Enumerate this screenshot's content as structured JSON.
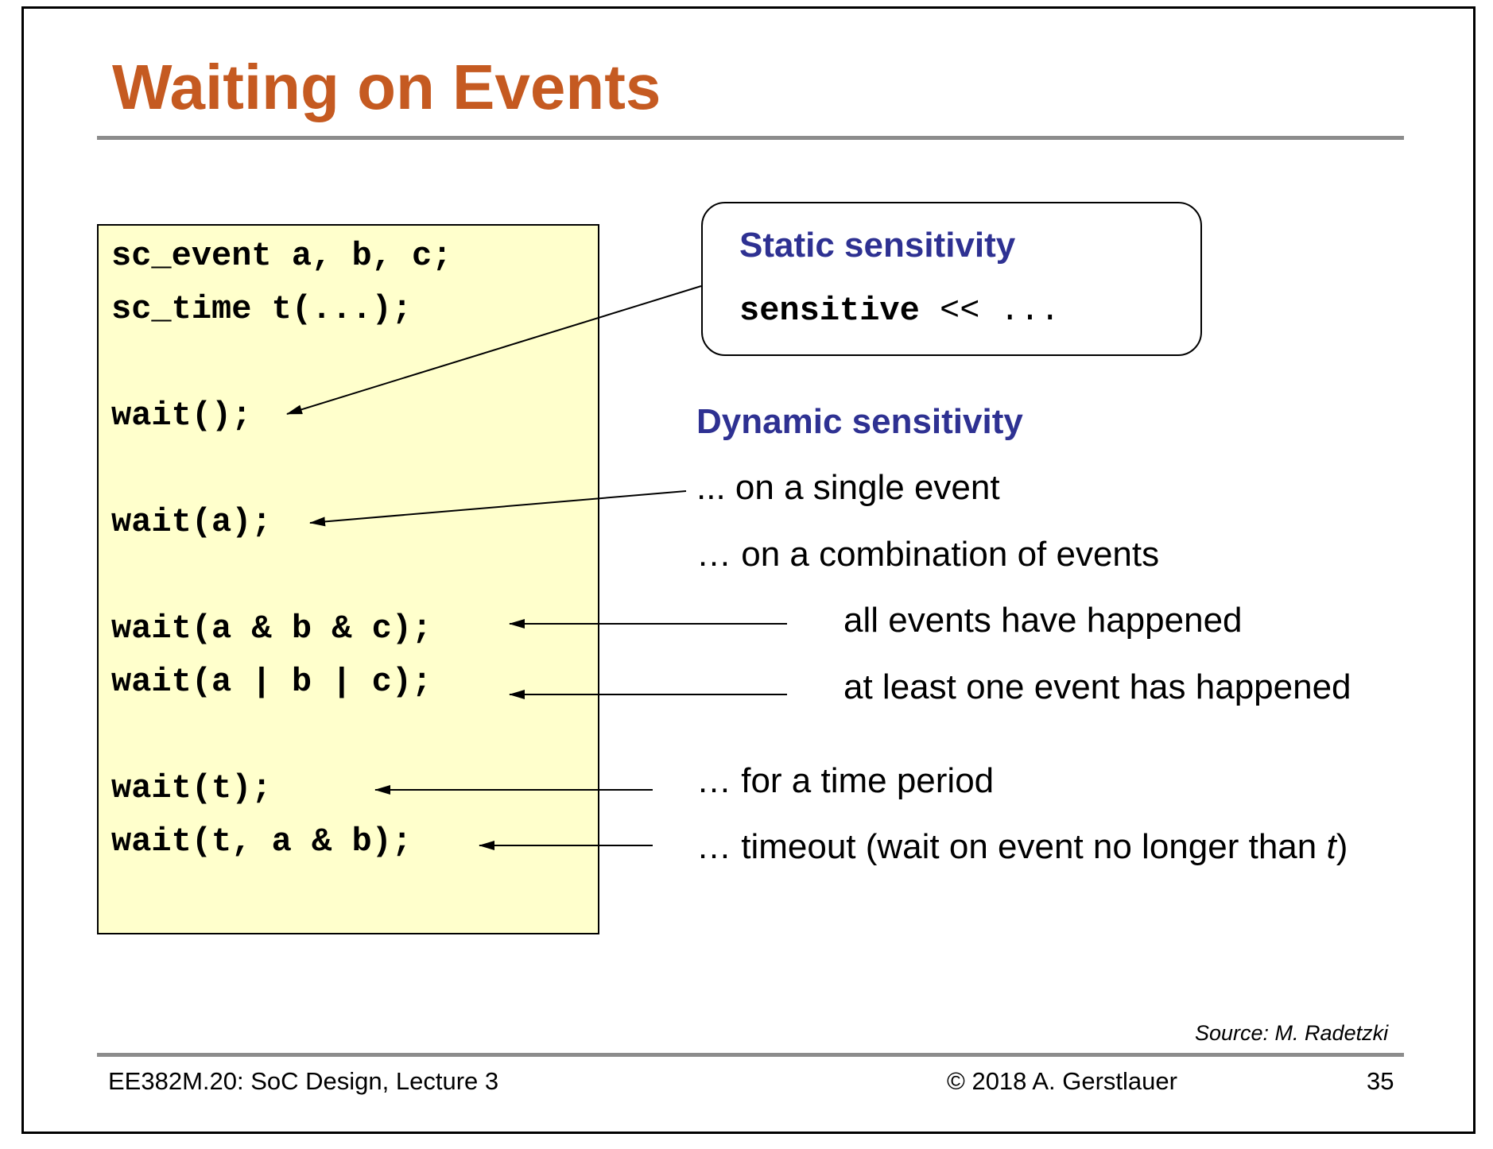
{
  "slide": {
    "title": "Waiting on Events",
    "code_lines": [
      "sc_event a, b, c;",
      "sc_time t(...);",
      "wait();",
      "wait(a);",
      "wait(a & b & c);",
      "wait(a | b | c);",
      "wait(t);",
      "wait(t, a & b);"
    ],
    "static_box": {
      "heading": "Static sensitivity",
      "keyword": "sensitive",
      "rest": " << ..."
    },
    "dynamic": {
      "heading": "Dynamic sensitivity",
      "single_event": "... on a single event",
      "combination": "… on a combination of events",
      "all_events": "all events have happened",
      "at_least_one": "at least one event has happened",
      "time_period": "… for a time period",
      "timeout_prefix": "… timeout (wait on event no longer than ",
      "timeout_var": "t",
      "timeout_suffix": ")"
    },
    "source": "Source: M. Radetzki",
    "footer": {
      "course": "EE382M.20: SoC Design, Lecture 3",
      "copyright": "© 2018 A. Gerstlauer",
      "page_number": "35"
    },
    "colors": {
      "title": "#c55a21",
      "heading": "#2e3192",
      "code_background": "#ffffcc",
      "rule": "#8c8c8c"
    }
  }
}
